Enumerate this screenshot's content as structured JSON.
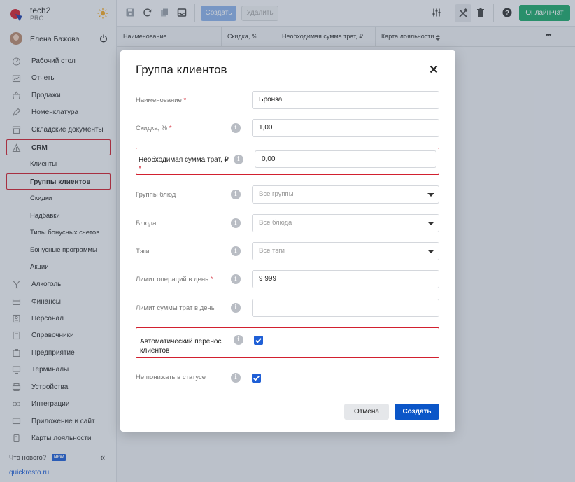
{
  "brand": {
    "name": "tech2",
    "plan": "PRO"
  },
  "user": {
    "name": "Елена Бажова"
  },
  "sidebar": {
    "items": [
      {
        "label": "Рабочий стол",
        "icon": "dashboard-icon"
      },
      {
        "label": "Отчеты",
        "icon": "reports-icon"
      },
      {
        "label": "Продажи",
        "icon": "sales-icon"
      },
      {
        "label": "Номенклатура",
        "icon": "nomenclature-icon"
      },
      {
        "label": "Складские документы",
        "icon": "warehouse-icon"
      },
      {
        "label": "CRM",
        "icon": "crm-icon"
      },
      {
        "label": "Алкоголь",
        "icon": "alcohol-icon"
      },
      {
        "label": "Финансы",
        "icon": "finance-icon"
      },
      {
        "label": "Персонал",
        "icon": "staff-icon"
      },
      {
        "label": "Справочники",
        "icon": "reference-icon"
      },
      {
        "label": "Предприятие",
        "icon": "enterprise-icon"
      },
      {
        "label": "Терминалы",
        "icon": "terminal-icon"
      },
      {
        "label": "Устройства",
        "icon": "devices-icon"
      },
      {
        "label": "Интеграции",
        "icon": "integrations-icon"
      },
      {
        "label": "Приложение и сайт",
        "icon": "app-site-icon"
      },
      {
        "label": "Карты лояльности",
        "icon": "loyalty-card-icon"
      }
    ],
    "crm_sub": [
      {
        "label": "Клиенты"
      },
      {
        "label": "Группы клиентов"
      },
      {
        "label": "Скидки"
      },
      {
        "label": "Надбавки"
      },
      {
        "label": "Типы бонусных счетов"
      },
      {
        "label": "Бонусные программы"
      },
      {
        "label": "Акции"
      }
    ],
    "whats_new": "Что нового?",
    "new_badge": "NEW",
    "collapse": "«",
    "site_link": "quickresto.ru"
  },
  "toolbar": {
    "create_label": "Создать",
    "delete_label": "Удалить",
    "chat_label": "Онлайн-чат"
  },
  "table": {
    "columns": [
      "Наименование",
      "Скидка, %",
      "Необходимая сумма трат, ₽",
      "Карта лояльности"
    ],
    "more": "•••"
  },
  "modal": {
    "title": "Группа клиентов",
    "fields": {
      "name": {
        "label": "Наименование",
        "value": "Бронза"
      },
      "discount": {
        "label": "Скидка, %",
        "value": "1,00"
      },
      "required_sum": {
        "label": "Необходимая сумма трат, ₽",
        "value": "0,00"
      },
      "dish_groups": {
        "label": "Группы блюд",
        "placeholder": "Все группы"
      },
      "dishes": {
        "label": "Блюда",
        "placeholder": "Все блюда"
      },
      "tags": {
        "label": "Тэги",
        "placeholder": "Все тэги"
      },
      "ops_limit": {
        "label": "Лимит операций в день",
        "value": "9 999"
      },
      "spend_limit": {
        "label": "Лимит суммы трат в день",
        "value": ""
      },
      "auto_transfer": {
        "label": "Автоматический перенос клиентов",
        "checked": true
      },
      "no_downgrade": {
        "label": "Не понижать в статусе",
        "checked": true
      }
    },
    "required_mark": "*",
    "info_glyph": "i",
    "cancel_label": "Отмена",
    "create_label": "Создать"
  },
  "colors": {
    "primary": "#0b56c8",
    "chat": "#1ea86a",
    "highlight": "#d2202f"
  }
}
